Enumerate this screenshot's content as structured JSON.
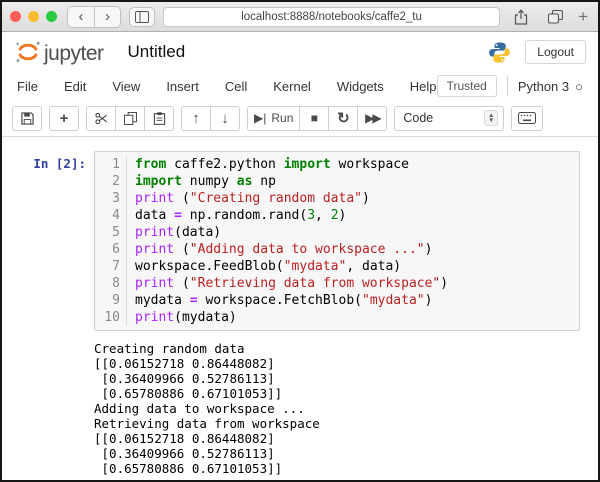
{
  "browser": {
    "url": "localhost:8888/notebooks/caffe2_tu",
    "new_tab_label": "+"
  },
  "icons": {
    "back": "‹",
    "forward": "›",
    "add_cell": "+",
    "move_up": "↑",
    "move_down": "↓",
    "run_play": "▶|",
    "stop": "■",
    "restart": "↻",
    "run_all": "▶▶",
    "stepper_up": "▲",
    "stepper_down": "▼",
    "kernel_idle": "○"
  },
  "header": {
    "logo_text": "jupyter",
    "title": "Untitled",
    "logout_label": "Logout"
  },
  "menubar": {
    "items": [
      "File",
      "Edit",
      "View",
      "Insert",
      "Cell",
      "Kernel",
      "Widgets",
      "Help"
    ],
    "trusted_label": "Trusted",
    "kernel_name": "Python 3"
  },
  "toolbar": {
    "run_label": "Run",
    "cell_type": "Code"
  },
  "cell": {
    "prompt": "In [2]:",
    "lines": [
      {
        "num": "1",
        "tokens": [
          [
            "kw",
            "from"
          ],
          [
            "pl",
            " caffe2.python "
          ],
          [
            "kw",
            "import"
          ],
          [
            "pl",
            " workspace"
          ]
        ]
      },
      {
        "num": "2",
        "tokens": [
          [
            "kw",
            "import"
          ],
          [
            "pl",
            " numpy "
          ],
          [
            "kw",
            "as"
          ],
          [
            "pl",
            " np"
          ]
        ]
      },
      {
        "num": "3",
        "tokens": [
          [
            "bi",
            "print"
          ],
          [
            "pl",
            " ("
          ],
          [
            "str",
            "\"Creating random data\""
          ],
          [
            "pl",
            ")"
          ]
        ]
      },
      {
        "num": "4",
        "tokens": [
          [
            "pl",
            "data "
          ],
          [
            "op",
            "="
          ],
          [
            "pl",
            " np.random.rand("
          ],
          [
            "num",
            "3"
          ],
          [
            "pl",
            ", "
          ],
          [
            "num",
            "2"
          ],
          [
            "pl",
            ")"
          ]
        ]
      },
      {
        "num": "5",
        "tokens": [
          [
            "bi",
            "print"
          ],
          [
            "pl",
            "(data)"
          ]
        ]
      },
      {
        "num": "6",
        "tokens": [
          [
            "bi",
            "print"
          ],
          [
            "pl",
            " ("
          ],
          [
            "str",
            "\"Adding data to workspace ...\""
          ],
          [
            "pl",
            ")"
          ]
        ]
      },
      {
        "num": "7",
        "tokens": [
          [
            "pl",
            "workspace.FeedBlob("
          ],
          [
            "str",
            "\"mydata\""
          ],
          [
            "pl",
            ", data)"
          ]
        ]
      },
      {
        "num": "8",
        "tokens": [
          [
            "bi",
            "print"
          ],
          [
            "pl",
            " ("
          ],
          [
            "str",
            "\"Retrieving data from workspace\""
          ],
          [
            "pl",
            ")"
          ]
        ]
      },
      {
        "num": "9",
        "tokens": [
          [
            "pl",
            "mydata "
          ],
          [
            "op",
            "="
          ],
          [
            "pl",
            " workspace.FetchBlob("
          ],
          [
            "str",
            "\"mydata\""
          ],
          [
            "pl",
            ")"
          ]
        ]
      },
      {
        "num": "10",
        "tokens": [
          [
            "bi",
            "print"
          ],
          [
            "pl",
            "(mydata)"
          ]
        ]
      }
    ]
  },
  "output": {
    "text": "Creating random data\n[[0.06152718 0.86448082]\n [0.36409966 0.52786113]\n [0.65780886 0.67101053]]\nAdding data to workspace ...\nRetrieving data from workspace\n[[0.06152718 0.86448082]\n [0.36409966 0.52786113]\n [0.65780886 0.67101053]]"
  }
}
